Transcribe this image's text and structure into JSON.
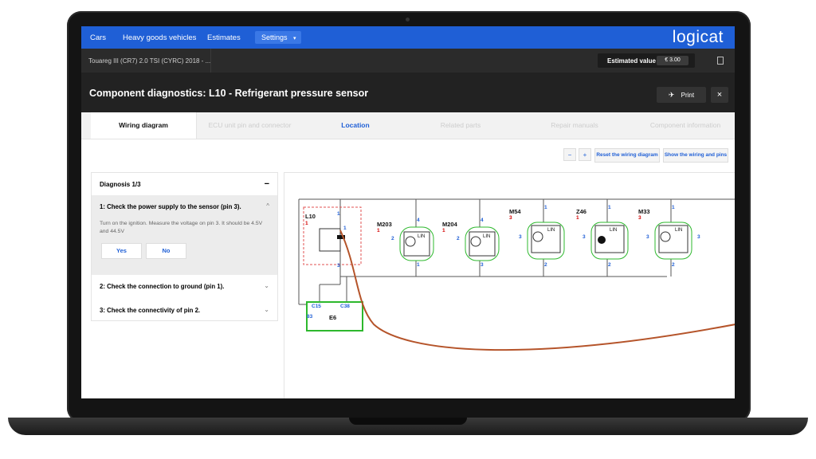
{
  "nav": {
    "links": [
      "Cars",
      "Heavy goods vehicles",
      "Estimates"
    ],
    "settings_label": "Settings",
    "settings_caret": "▾",
    "logo": "logicat"
  },
  "vehicle_bar": {
    "vehicle": "Touareg III (CR7) 2.0 TSI (CYRC) 2018 - ...",
    "estimate_label": "Estimated value",
    "estimate_value": "€ 3.00"
  },
  "title_bar": {
    "title": "Component diagnostics: L10 - Refrigerant pressure sensor",
    "print_label": "Print",
    "close_label": "×"
  },
  "tabs": [
    {
      "label": "Wiring diagram",
      "state": "active"
    },
    {
      "label": "ECU unit pin and connector",
      "state": "disabled"
    },
    {
      "label": "Location",
      "state": "link"
    },
    {
      "label": "Related parts",
      "state": "disabled"
    },
    {
      "label": "Repair manuals",
      "state": "disabled"
    },
    {
      "label": "Component information",
      "state": "disabled"
    }
  ],
  "toolbar": {
    "zoom_out": "−",
    "zoom_in": "+",
    "reset": "Reset the wiring diagram",
    "show_pins": "Show the wiring and pins"
  },
  "diagnosis": {
    "header": "Diagnosis 1/3",
    "collapse_symbol": "−",
    "steps": [
      {
        "title": "1: Check the power supply to the sensor (pin 3).",
        "description": "Turn on the ignition. Measure the voltage on pin 3. It should be 4.5V and 44.5V",
        "yes": "Yes",
        "no": "No"
      },
      {
        "title": "2: Check the connection to ground (pin 1)."
      },
      {
        "title": "3: Check the connectivity of pin 2."
      }
    ],
    "chevron_up": "^",
    "chevron_down": "⌄"
  },
  "diagram": {
    "components": [
      {
        "id": "L10",
        "ref": "1"
      },
      {
        "id": "M203",
        "ref": "1"
      },
      {
        "id": "M204",
        "ref": "1"
      },
      {
        "id": "M54",
        "ref": "3"
      },
      {
        "id": "Z46",
        "ref": "1"
      },
      {
        "id": "M33",
        "ref": "3"
      }
    ],
    "pin_labels": [
      "1",
      "2",
      "3",
      "4",
      "1",
      "2",
      "3",
      "4",
      "1",
      "2",
      "3",
      "1",
      "2",
      "3",
      "1",
      "2",
      "3",
      "1",
      "3"
    ],
    "bus_label": "LIN",
    "ecu": {
      "id": "E6",
      "connectors": [
        "C15",
        "C38"
      ],
      "pin": "83"
    },
    "colors": {
      "wire": "#b5542a",
      "highlight": "#2db82d",
      "selection": "#e05050",
      "pins": "#1f5fd6"
    }
  }
}
